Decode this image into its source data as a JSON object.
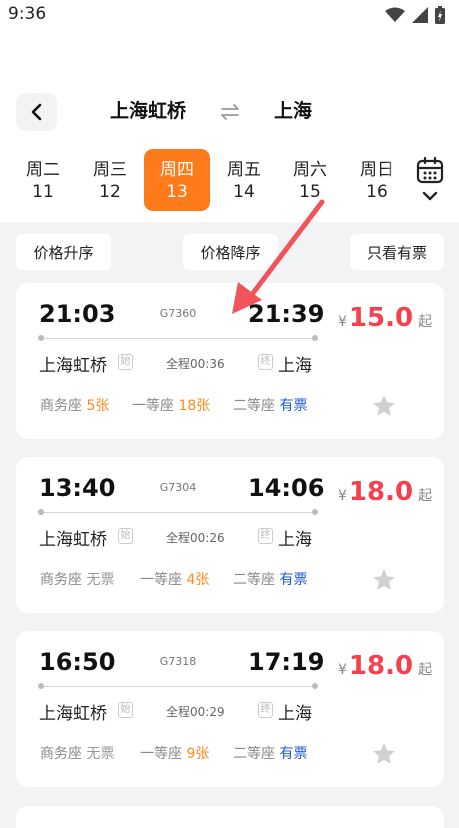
{
  "status_bar": {
    "time": "9:36"
  },
  "header": {
    "from_station": "上海虹桥",
    "to_station": "上海"
  },
  "date_tabs": [
    {
      "weekday": "周二",
      "day": "11",
      "active": false
    },
    {
      "weekday": "周三",
      "day": "12",
      "active": false
    },
    {
      "weekday": "周四",
      "day": "13",
      "active": true
    },
    {
      "weekday": "周五",
      "day": "14",
      "active": false
    },
    {
      "weekday": "周六",
      "day": "15",
      "active": false
    },
    {
      "weekday": "周日",
      "day": "16",
      "active": false
    }
  ],
  "sort_buttons": {
    "price_asc": "价格升序",
    "price_desc": "价格降序",
    "only_available": "只看有票"
  },
  "trains": [
    {
      "dep_time": "21:03",
      "arr_time": "21:39",
      "train_no": "G7360",
      "from": "上海虹桥",
      "to": "上海",
      "start_tag": "始",
      "end_tag": "终",
      "duration": "全程00:36",
      "currency": "¥",
      "price": "15.0",
      "price_suffix": "起",
      "seats": [
        {
          "label": "商务座",
          "avail": "5张",
          "status": "num"
        },
        {
          "label": "一等座",
          "avail": "18张",
          "status": "num"
        },
        {
          "label": "二等座",
          "avail": "有票",
          "status": "yes"
        }
      ]
    },
    {
      "dep_time": "13:40",
      "arr_time": "14:06",
      "train_no": "G7304",
      "from": "上海虹桥",
      "to": "上海",
      "start_tag": "始",
      "end_tag": "终",
      "duration": "全程00:26",
      "currency": "¥",
      "price": "18.0",
      "price_suffix": "起",
      "seats": [
        {
          "label": "商务座",
          "avail": "无票",
          "status": "none"
        },
        {
          "label": "一等座",
          "avail": "4张",
          "status": "num"
        },
        {
          "label": "二等座",
          "avail": "有票",
          "status": "yes"
        }
      ]
    },
    {
      "dep_time": "16:50",
      "arr_time": "17:19",
      "train_no": "G7318",
      "from": "上海虹桥",
      "to": "上海",
      "start_tag": "始",
      "end_tag": "终",
      "duration": "全程00:29",
      "currency": "¥",
      "price": "18.0",
      "price_suffix": "起",
      "seats": [
        {
          "label": "商务座",
          "avail": "无票",
          "status": "none"
        },
        {
          "label": "一等座",
          "avail": "9张",
          "status": "num"
        },
        {
          "label": "二等座",
          "avail": "有票",
          "status": "yes"
        }
      ]
    }
  ],
  "icons": {
    "back": "chevron-left-icon",
    "swap": "swap-arrows-icon",
    "calendar": "calendar-icon",
    "expand": "chevron-down-icon",
    "favorite": "star-icon",
    "annotation": "red-arrow-annotation"
  },
  "colors": {
    "accent": "#ff7a1a",
    "price": "#f5404d",
    "seat_count": "#ff8a1c",
    "seat_available": "#1e5bd8",
    "annotation_arrow": "#f2545b"
  }
}
